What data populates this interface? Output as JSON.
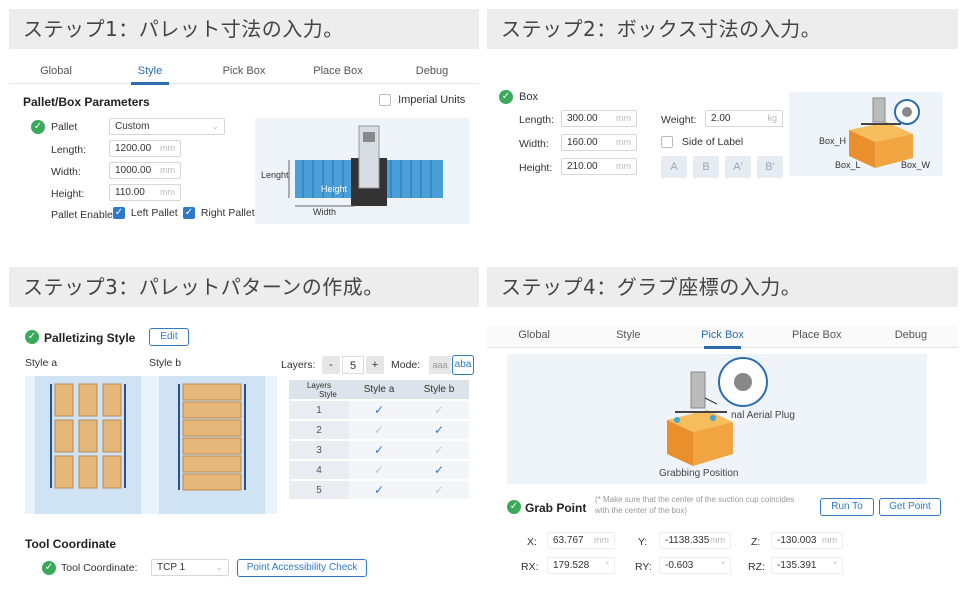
{
  "step1": {
    "header": "ステップ1：パレット寸法の入力。",
    "tabs": [
      "Global",
      "Style",
      "Pick Box",
      "Place Box",
      "Debug"
    ],
    "section_title": "Pallet/Box Parameters",
    "imperial_label": "Imperial Units",
    "pallet_label": "Pallet",
    "pallet_select": "Custom",
    "length_label": "Length:",
    "length_value": "1200.00",
    "width_label": "Width:",
    "width_value": "1000.00",
    "height_label": "Height:",
    "height_value": "110.00",
    "unit": "mm",
    "enable_label": "Pallet Enable:",
    "left_pallet": "Left Pallet",
    "right_pallet": "Right Pallet",
    "illus_length": "Lenght",
    "illus_width": "Width",
    "illus_height": "Height"
  },
  "step2": {
    "header": "ステップ2：ボックス寸法の入力。",
    "box_label": "Box",
    "length_label": "Length:",
    "length_value": "300.00",
    "width_label": "Width:",
    "width_value": "160.00",
    "height_label": "Height:",
    "height_value": "210.00",
    "weight_label": "Weight:",
    "weight_value": "2.00",
    "unit": "mm",
    "weight_unit": "kg",
    "side_label": "Side of Label",
    "faces": [
      "A",
      "B",
      "A'",
      "B'"
    ],
    "illus_box_h": "Box_H",
    "illus_box_l": "Box_L",
    "illus_box_w": "Box_W"
  },
  "step3": {
    "header": "ステップ3：パレットパターンの作成。",
    "title": "Palletizing Style",
    "edit": "Edit",
    "style_a": "Style a",
    "style_b": "Style b",
    "layers_label": "Layers:",
    "layers_value": "5",
    "minus": "-",
    "plus": "+",
    "mode_label": "Mode:",
    "mode_aaa": "aaa",
    "mode_aba": "aba",
    "table_head_layers": "Layers",
    "table_head_style": "Style",
    "col_a": "Style a",
    "col_b": "Style b",
    "rows": [
      {
        "n": "1",
        "a": true,
        "b": false
      },
      {
        "n": "2",
        "a": false,
        "b": true
      },
      {
        "n": "3",
        "a": true,
        "b": false
      },
      {
        "n": "4",
        "a": false,
        "b": true
      },
      {
        "n": "5",
        "a": true,
        "b": false
      }
    ],
    "tool_title": "Tool Coordinate",
    "tool_label": "Tool Coordinate:",
    "tool_value": "TCP 1",
    "check_btn": "Point Accessibility Check"
  },
  "step4": {
    "header": "ステップ4：グラブ座標の入力。",
    "tabs": [
      "Global",
      "Style",
      "Pick Box",
      "Place Box",
      "Debug"
    ],
    "illus_plug": "nal Aerial Plug",
    "illus_grab": "Grabbing Position",
    "grab_title": "Grab Point",
    "note": "(* Make sure that the center of the suction cup coincides with the center of the box)",
    "run_to": "Run To",
    "get_point": "Get Point",
    "x_label": "X:",
    "x_value": "63.767",
    "y_label": "Y:",
    "y_value": "-1138.335",
    "z_label": "Z:",
    "z_value": "-130.003",
    "rx_label": "RX:",
    "rx_value": "179.528",
    "ry_label": "RY:",
    "ry_value": "-0.603",
    "rz_label": "RZ:",
    "rz_value": "-135.391",
    "unit": "mm",
    "deg": "°"
  },
  "colors": {
    "accent": "#2f79c9",
    "ok": "#3aaa5a",
    "header_bg": "#ededed",
    "box": "#f0a541"
  }
}
